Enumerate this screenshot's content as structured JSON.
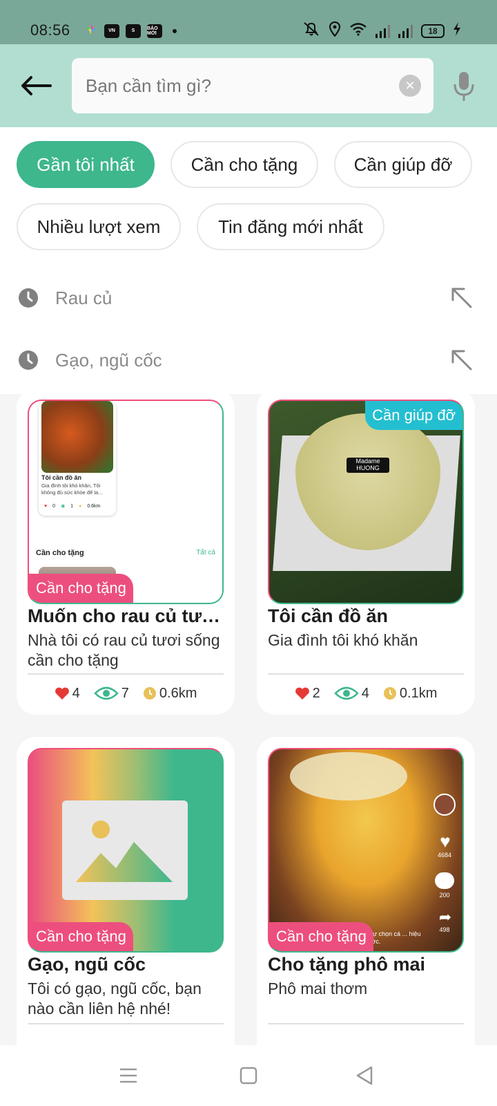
{
  "status_bar": {
    "time": "08:56",
    "battery": "18",
    "app_icons": [
      "VN",
      "S",
      "BÁO MỚI"
    ]
  },
  "search": {
    "placeholder": "Bạn cần tìm gì?",
    "value": ""
  },
  "filters": [
    {
      "label": "Gần tôi nhất",
      "active": true
    },
    {
      "label": "Cần cho tặng",
      "active": false
    },
    {
      "label": "Cần giúp đỡ",
      "active": false
    },
    {
      "label": "Nhiều lượt xem",
      "active": false
    },
    {
      "label": "Tin đăng mới nhất",
      "active": false
    }
  ],
  "recent_searches": [
    {
      "label": "Rau củ",
      "icon": "clock-icon"
    },
    {
      "label": "Gạo, ngũ cốc",
      "icon": "clock-icon"
    }
  ],
  "posts": [
    {
      "tag": "Cần cho tặng",
      "title": "Muốn cho rau củ tươi sống",
      "description": "Nhà tôi có rau củ tươi sống cần cho tặng",
      "likes": "4",
      "views": "7",
      "distance": "0.6km",
      "preview": {
        "title": "Tôi cần đồ ăn",
        "desc": "Gia đình tôi khó khăn, Tôi không đủ sức khỏe để la...",
        "likes": "0",
        "views": "1",
        "distance": "0.6km",
        "section": "Cần cho tặng",
        "see_all": "Tất cả"
      }
    },
    {
      "tag": "Cần giúp đỡ",
      "title": "Tôi cần đồ ăn",
      "description": "Gia đình tôi khó khăn",
      "likes": "2",
      "views": "4",
      "distance": "0.1km",
      "photo_text": [
        "Madame",
        "HUONG"
      ]
    },
    {
      "tag": "Cần cho tặng",
      "title": "Gạo, ngũ cốc",
      "description": "Tôi có gạo, ngũ cốc, bạn nào cần liên hệ nhé!"
    },
    {
      "tag": "Cần cho tặng",
      "title": "Cho tặng phô mai",
      "description": "Phô mai thơm",
      "video_counts": [
        "4684",
        "200",
        "498"
      ],
      "video_caption": "e tự chọn cá ... hiệu tước."
    }
  ],
  "colors": {
    "status_bar": "#79a898",
    "header": "#b1ded0",
    "accent": "#3eb78d",
    "tag_give": "#ec4f7e",
    "tag_help": "#23bfd0",
    "heart": "#e53935",
    "eye": "#3eb78d",
    "clock": "#e8c15a"
  }
}
